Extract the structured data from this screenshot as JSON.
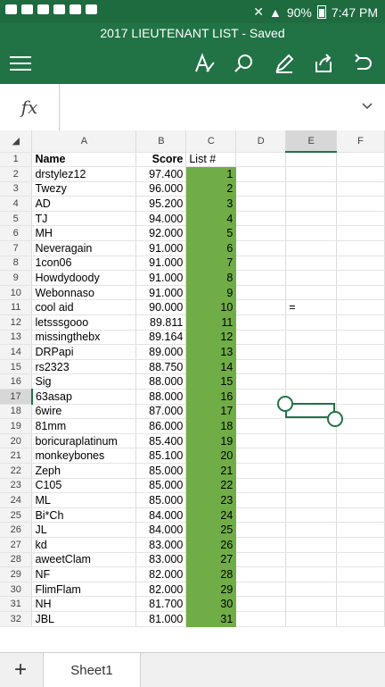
{
  "status_bar": {
    "battery": "90%",
    "time": "7:47 PM"
  },
  "title": "2017 LIEUTENANT LIST - Saved",
  "toolbar": {
    "menu_icon": "hamburger-icon",
    "format_icon": "text-format-icon",
    "search_icon": "search-icon",
    "draw_icon": "pen-icon",
    "share_icon": "share-icon",
    "undo_icon": "undo-icon"
  },
  "formula_bar": {
    "fx_label": "fx",
    "value": "",
    "expand_icon": "chevron-down-icon"
  },
  "columns": [
    "A",
    "B",
    "C",
    "D",
    "E",
    "F"
  ],
  "rows": [
    {
      "n": "1",
      "a": "Name",
      "b": "Score",
      "c": "List #",
      "e": ""
    },
    {
      "n": "2",
      "a": "drstylez12",
      "b": "97.400",
      "c": "1",
      "e": ""
    },
    {
      "n": "3",
      "a": "Twezy",
      "b": "96.000",
      "c": "2",
      "e": ""
    },
    {
      "n": "4",
      "a": "AD",
      "b": "95.200",
      "c": "3",
      "e": ""
    },
    {
      "n": "5",
      "a": "TJ",
      "b": "94.000",
      "c": "4",
      "e": ""
    },
    {
      "n": "6",
      "a": "MH",
      "b": "92.000",
      "c": "5",
      "e": ""
    },
    {
      "n": "7",
      "a": "Neveragain",
      "b": "91.000",
      "c": "6",
      "e": ""
    },
    {
      "n": "8",
      "a": "1con06",
      "b": "91.000",
      "c": "7",
      "e": ""
    },
    {
      "n": "9",
      "a": "Howdydoody",
      "b": "91.000",
      "c": "8",
      "e": ""
    },
    {
      "n": "10",
      "a": "Webonnaso",
      "b": "91.000",
      "c": "9",
      "e": ""
    },
    {
      "n": "11",
      "a": "cool aid",
      "b": "90.000",
      "c": "10",
      "e": "="
    },
    {
      "n": "12",
      "a": "letsssgooo",
      "b": "89.811",
      "c": "11",
      "e": ""
    },
    {
      "n": "13",
      "a": "missingthebx",
      "b": "89.164",
      "c": "12",
      "e": ""
    },
    {
      "n": "14",
      "a": "DRPapi",
      "b": "89.000",
      "c": "13",
      "e": ""
    },
    {
      "n": "15",
      "a": "rs2323",
      "b": "88.750",
      "c": "14",
      "e": ""
    },
    {
      "n": "16",
      "a": "Sig",
      "b": "88.000",
      "c": "15",
      "e": ""
    },
    {
      "n": "17",
      "a": "63asap",
      "b": "88.000",
      "c": "16",
      "e": ""
    },
    {
      "n": "18",
      "a": "6wire",
      "b": "87.000",
      "c": "17",
      "e": ""
    },
    {
      "n": "19",
      "a": "81mm",
      "b": "86.000",
      "c": "18",
      "e": ""
    },
    {
      "n": "20",
      "a": "boricuraplatinum",
      "b": "85.400",
      "c": "19",
      "e": ""
    },
    {
      "n": "21",
      "a": "monkeybones",
      "b": "85.100",
      "c": "20",
      "e": ""
    },
    {
      "n": "22",
      "a": "Zeph",
      "b": "85.000",
      "c": "21",
      "e": ""
    },
    {
      "n": "23",
      "a": "C105",
      "b": "85.000",
      "c": "22",
      "e": ""
    },
    {
      "n": "24",
      "a": "ML",
      "b": "85.000",
      "c": "23",
      "e": ""
    },
    {
      "n": "25",
      "a": "Bi*Ch",
      "b": "84.000",
      "c": "24",
      "e": ""
    },
    {
      "n": "26",
      "a": "JL",
      "b": "84.000",
      "c": "25",
      "e": ""
    },
    {
      "n": "27",
      "a": "kd",
      "b": "83.000",
      "c": "26",
      "e": ""
    },
    {
      "n": "28",
      "a": "aweetClam",
      "b": "83.000",
      "c": "27",
      "e": ""
    },
    {
      "n": "29",
      "a": "NF",
      "b": "82.000",
      "c": "28",
      "e": ""
    },
    {
      "n": "30",
      "a": "FlimFlam",
      "b": "82.000",
      "c": "29",
      "e": ""
    },
    {
      "n": "31",
      "a": "NH",
      "b": "81.700",
      "c": "30",
      "e": ""
    },
    {
      "n": "32",
      "a": "JBL",
      "b": "81.000",
      "c": "31",
      "e": ""
    }
  ],
  "sheet_tabs": {
    "add_label": "+",
    "active": "Sheet1"
  },
  "colors": {
    "accent": "#217346",
    "highlight": "#70ad47"
  }
}
